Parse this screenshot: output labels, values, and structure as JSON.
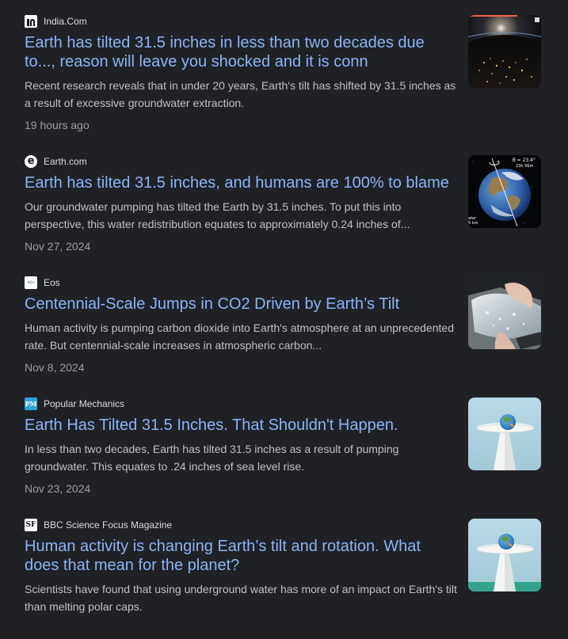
{
  "results": [
    {
      "source": "India.Com",
      "title": "Earth has tilted 31.5 inches in less than two decades due to..., reason will leave you shocked and it is conn",
      "snippet": "Recent research reveals that in under 20 years, Earth's tilt has shifted by 31.5 inches as a result of excessive groundwater extraction.",
      "date": "19 hours ago"
    },
    {
      "source": "Earth.com",
      "favicon_glyph": "e",
      "title": "Earth has tilted 31.5 inches, and humans are 100% to blame",
      "snippet": "Our groundwater pumping has tilted the Earth by 31.5 inches. To put this into perspective, this water redistribution equates to approximately 0.24 inches of...",
      "date": "Nov 27, 2024",
      "thumb_text": {
        "angle": "θ = 23.4°",
        "time": "23h 56m",
        "cut1": "ater",
        "cut2": "5 km"
      }
    },
    {
      "source": "Eos",
      "favicon_glyph": "AGU",
      "title": "Centennial-Scale Jumps in CO2 Driven by Earth’s Tilt",
      "snippet": "Human activity is pumping carbon dioxide into Earth's atmosphere at an unprecedented rate. But centennial-scale increases in atmospheric carbon...",
      "date": "Nov 8, 2024"
    },
    {
      "source": "Popular Mechanics",
      "favicon_glyph": "PM",
      "title": "Earth Has Tilted 31.5 Inches. That Shouldn't Happen.",
      "snippet": "In less than two decades, Earth has tilted 31.5 inches as a result of pumping groundwater. This equates to .24 inches of sea level rise.",
      "date": "Nov 23, 2024"
    },
    {
      "source": "BBC Science Focus Magazine",
      "favicon_glyph": "SF",
      "title": "Human activity is changing Earth’s tilt and rotation. What does that mean for the planet?",
      "snippet": "Scientists have found that using underground water has more of an impact on Earth's tilt than melting polar caps.",
      "date": ""
    }
  ],
  "colors": {
    "background": "#202124",
    "title": "#8ab4f8",
    "snippet": "#bdc1c6",
    "date": "#9aa0a6"
  }
}
